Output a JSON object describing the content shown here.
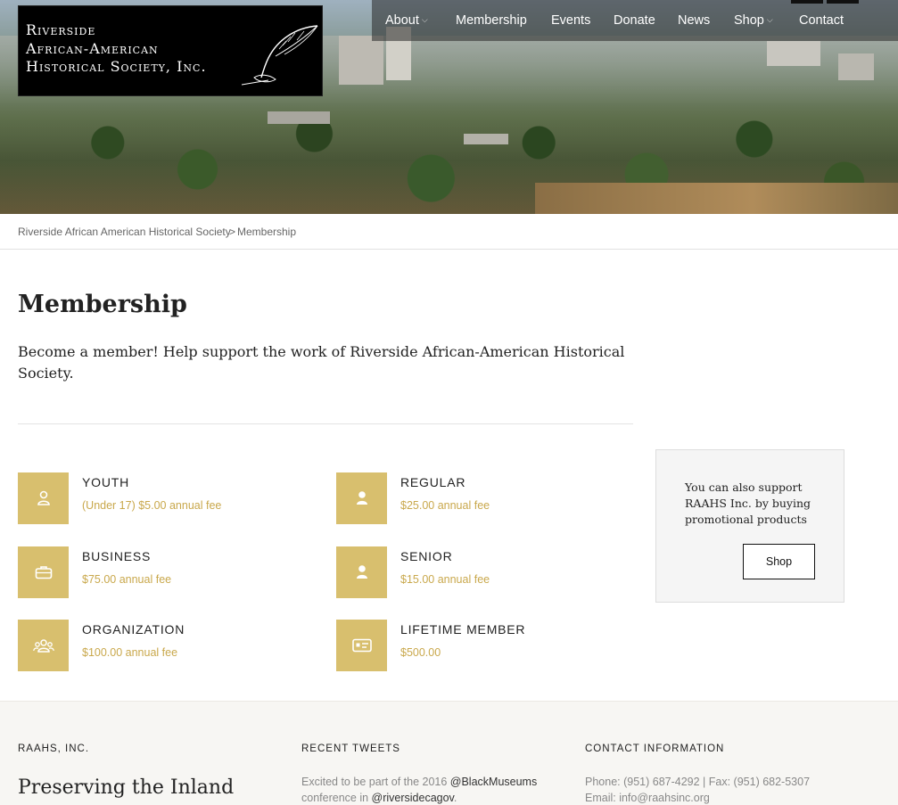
{
  "logo": {
    "line1": "Riverside",
    "line2": "African-American",
    "line3": "Historical Society, Inc."
  },
  "nav": {
    "items": [
      {
        "label": "About",
        "has_dropdown": true
      },
      {
        "label": "Membership",
        "has_dropdown": false
      },
      {
        "label": "Events",
        "has_dropdown": false
      },
      {
        "label": "Donate",
        "has_dropdown": false
      },
      {
        "label": "News",
        "has_dropdown": false
      },
      {
        "label": "Shop",
        "has_dropdown": true
      },
      {
        "label": "Contact",
        "has_dropdown": false
      }
    ],
    "chevron": "⌵"
  },
  "breadcrumb": {
    "home": "Riverside African American Historical Society",
    "separator": ">",
    "current": "Membership"
  },
  "page": {
    "title": "Membership",
    "intro": "Become a member! Help support the work of Riverside African-American Historical Society."
  },
  "tiers": [
    {
      "name": "YOUTH",
      "price": "(Under 17) $5.00 annual fee",
      "icon": "person-outline-icon"
    },
    {
      "name": "REGULAR",
      "price": "$25.00 annual fee",
      "icon": "person-icon"
    },
    {
      "name": "BUSINESS",
      "price": "$75.00 annual fee",
      "icon": "briefcase-icon"
    },
    {
      "name": "SENIOR",
      "price": "$15.00 annual fee",
      "icon": "person-icon"
    },
    {
      "name": "ORGANIZATION",
      "price": "$100.00 annual fee",
      "icon": "group-icon"
    },
    {
      "name": "LIFETIME MEMBER",
      "price": "$500.00",
      "icon": "id-card-icon"
    }
  ],
  "aside": {
    "text": "You can also support RAAHS Inc. by buying promotional products",
    "button": "Shop"
  },
  "footer": {
    "col1_heading": "RAAHS, INC.",
    "col1_tagline": "Preserving the Inland",
    "col2_heading": "RECENT TWEETS",
    "tweet_pre": "Excited to be part of the 2016 ",
    "tweet_mention1": "@BlackMuseums",
    "tweet_mid": "conference in ",
    "tweet_mention2": "@riversidecagov",
    "tweet_end": ".",
    "col3_heading": "CONTACT INFORMATION",
    "phone_line": "Phone: (951) 687-4292 | Fax: (951) 682-5307",
    "email_label": "Email: ",
    "email": "info@raahsinc.org"
  },
  "colors": {
    "accent_gold": "#d8bf6e",
    "price_gold": "#c9a84c"
  }
}
